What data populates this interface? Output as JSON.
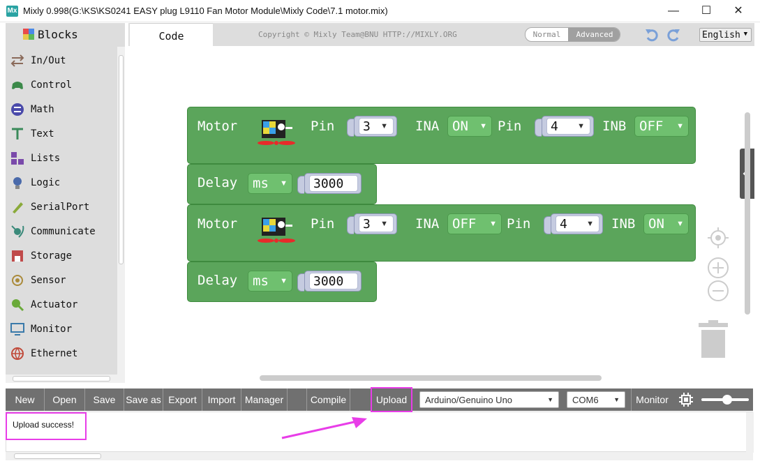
{
  "window": {
    "title": "Mixly 0.998(G:\\KS\\KS0241 EASY plug L9110 Fan Motor Module\\Mixly Code\\7.1 motor.mix)",
    "app_icon": "Mx",
    "controls": {
      "minimize": "—",
      "maximize": "☐",
      "close": "✕"
    }
  },
  "sidebar": {
    "blocks_label": "Blocks",
    "categories": [
      {
        "label": "In/Out",
        "icon": "arrows-icon",
        "color": "#8a6a5a"
      },
      {
        "label": "Control",
        "icon": "gamepad-icon",
        "color": "#3c8a4a"
      },
      {
        "label": "Math",
        "icon": "math-icon",
        "color": "#4a4aaa"
      },
      {
        "label": "Text",
        "icon": "text-icon",
        "color": "#3a8a5a"
      },
      {
        "label": "Lists",
        "icon": "lists-icon",
        "color": "#7a4aaa"
      },
      {
        "label": "Logic",
        "icon": "bulb-icon",
        "color": "#4a6aaa"
      },
      {
        "label": "SerialPort",
        "icon": "pen-icon",
        "color": "#8aaa3a"
      },
      {
        "label": "Communicate",
        "icon": "satellite-icon",
        "color": "#3a8a7a"
      },
      {
        "label": "Storage",
        "icon": "storage-icon",
        "color": "#c04a4a"
      },
      {
        "label": "Sensor",
        "icon": "sensor-icon",
        "color": "#aa8a3a"
      },
      {
        "label": "Actuator",
        "icon": "actuator-icon",
        "color": "#6aaa3a"
      },
      {
        "label": "Monitor",
        "icon": "monitor-icon",
        "color": "#3a7aaa"
      },
      {
        "label": "Ethernet",
        "icon": "globe-icon",
        "color": "#c04a3a"
      }
    ]
  },
  "topbar": {
    "code_tab": "Code",
    "copyright": "Copyright © Mixly Team@BNU HTTP://MIXLY.ORG",
    "mode_normal": "Normal",
    "mode_advanced": "Advanced",
    "language": "English"
  },
  "blocks": {
    "motor1": {
      "label": "Motor",
      "pin_label": "Pin",
      "pin": "3",
      "ina_label": "INA",
      "ina": "ON",
      "pin2_label": "Pin",
      "pin2": "4",
      "inb_label": "INB",
      "inb": "OFF"
    },
    "delay1": {
      "label": "Delay",
      "unit": "ms",
      "value": "3000"
    },
    "motor2": {
      "label": "Motor",
      "pin_label": "Pin",
      "pin": "3",
      "ina_label": "INA",
      "ina": "OFF",
      "pin2_label": "Pin",
      "pin2": "4",
      "inb_label": "INB",
      "inb": "ON"
    },
    "delay2": {
      "label": "Delay",
      "unit": "ms",
      "value": "3000"
    }
  },
  "toolbar": {
    "new": "New",
    "open": "Open",
    "save": "Save",
    "save_as": "Save as",
    "export": "Export",
    "import": "Import",
    "manager": "Manager",
    "compile": "Compile",
    "upload": "Upload",
    "board": "Arduino/Genuino Uno",
    "port": "COM6",
    "monitor": "Monitor"
  },
  "output": {
    "message": "Upload success!"
  },
  "colors": {
    "block_green": "#5ba55b",
    "highlight": "#e83de8",
    "toolbar": "#707070"
  }
}
